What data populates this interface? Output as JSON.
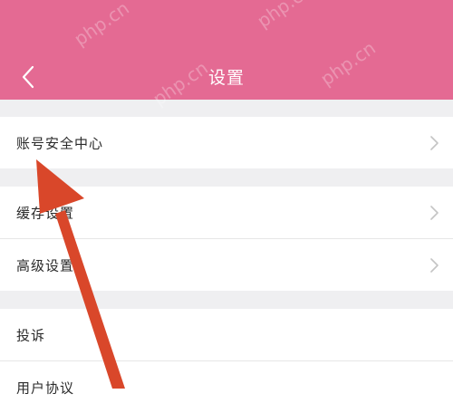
{
  "header": {
    "title": "设置",
    "watermark": "php.cn"
  },
  "groups": [
    {
      "items": [
        {
          "label": "账号安全中心",
          "icon": "chevron-right-icon"
        }
      ]
    },
    {
      "items": [
        {
          "label": "缓存设置",
          "icon": "chevron-right-icon"
        },
        {
          "label": "高级设置",
          "icon": "chevron-right-icon"
        }
      ]
    },
    {
      "items": [
        {
          "label": "投诉"
        },
        {
          "label": "用户协议"
        }
      ]
    }
  ],
  "colors": {
    "header_bg": "#e46a93",
    "page_bg": "#efeff1",
    "annotation_arrow": "#d9472a"
  }
}
